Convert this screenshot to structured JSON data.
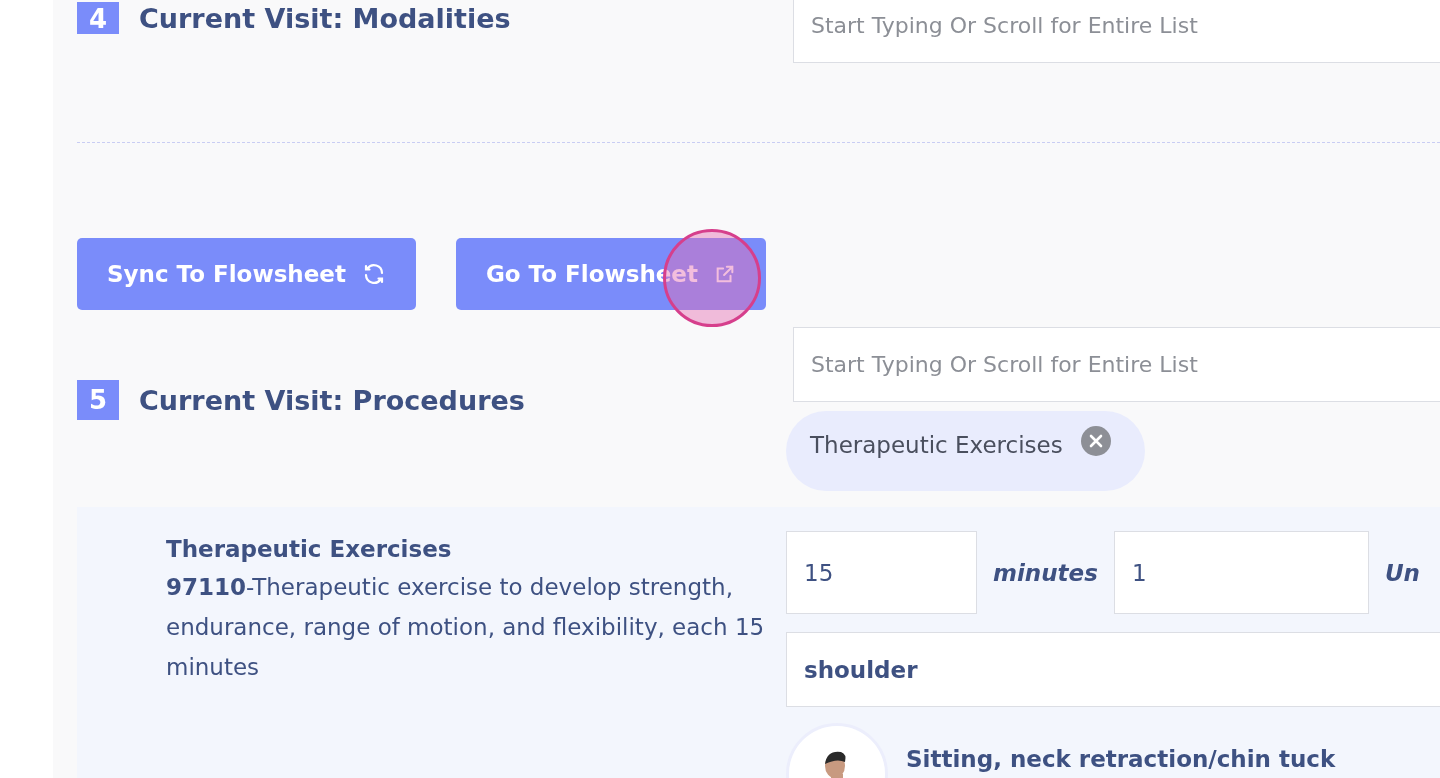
{
  "modalities": {
    "number": "4",
    "title": "Current Visit: Modalities",
    "search": {
      "placeholder": "Start Typing Or Scroll for Entire List"
    }
  },
  "actions": [
    {
      "label": "Sync To Flowsheet",
      "kind": "sync"
    },
    {
      "label": "Go To Flowsheet",
      "kind": "external"
    }
  ],
  "procedures": {
    "number": "5",
    "title": "Current Visit: Procedures",
    "search": {
      "placeholder": "Start Typing Or Scroll for Entire List"
    },
    "chips": [
      {
        "label": "Therapeutic Exercises"
      }
    ]
  },
  "procedure": {
    "name": "Therapeutic Exercises",
    "description": "**97110**-Therapeutic exercise to develop strength, endurance, range of motion, and flexibility, each 15 minutes",
    "minutes": "15",
    "minutes_label": "minutes",
    "units": "1",
    "units_label": "Un",
    "location": "shoulder",
    "exercises": [
      {
        "name": "Sitting, neck retraction/chin tuck"
      }
    ]
  }
}
